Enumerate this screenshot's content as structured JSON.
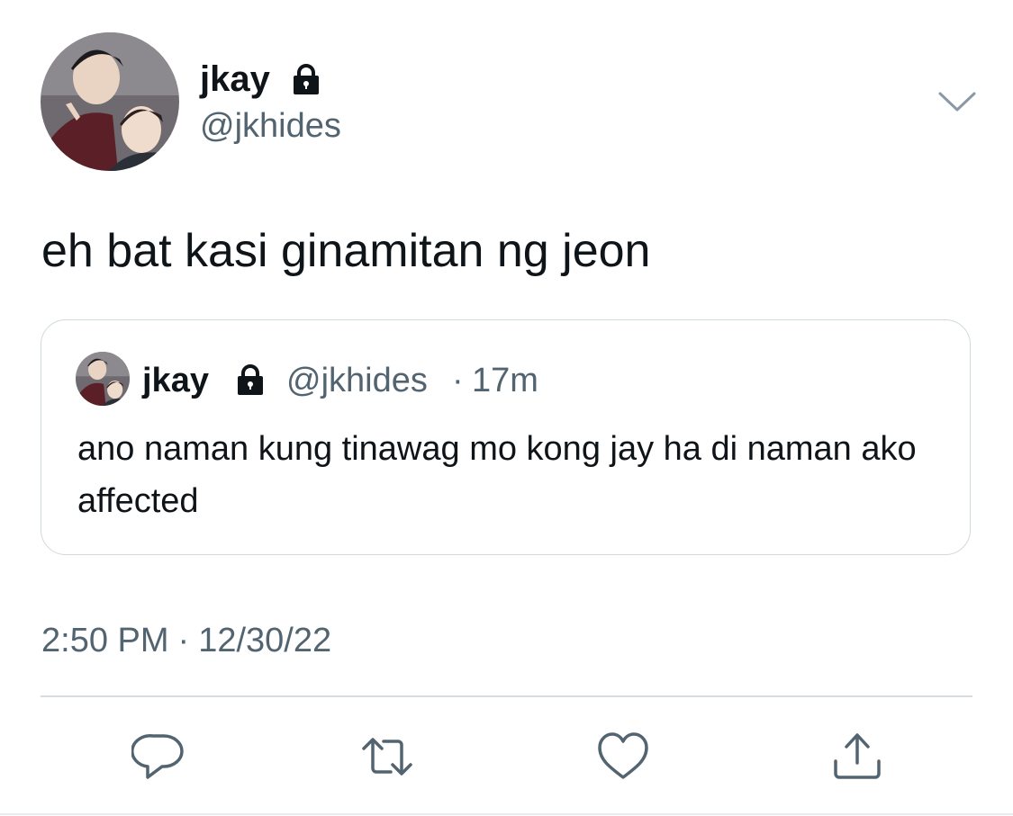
{
  "tweet": {
    "author": {
      "display_name": "jkay",
      "handle": "@jkhides",
      "avatar_icon": "avatar-photo",
      "protected_icon": "lock-icon"
    },
    "text": "eh bat kasi ginamitan ng jeon",
    "quoted": {
      "display_name": "jkay",
      "handle": "@jkhides",
      "separator": "·",
      "time_ago": "17m",
      "text": "ano naman kung tinawag mo kong jay ha di naman ako affected"
    },
    "timestamp": {
      "time": "2:50 PM",
      "separator": "·",
      "date": "12/30/22"
    }
  },
  "actions": [
    {
      "name": "reply",
      "icon": "reply-icon"
    },
    {
      "name": "retweet",
      "icon": "retweet-icon"
    },
    {
      "name": "like",
      "icon": "heart-icon"
    },
    {
      "name": "share",
      "icon": "share-icon"
    }
  ],
  "colors": {
    "text": "#0f1419",
    "secondary": "#536471",
    "border": "#cfd9de"
  }
}
